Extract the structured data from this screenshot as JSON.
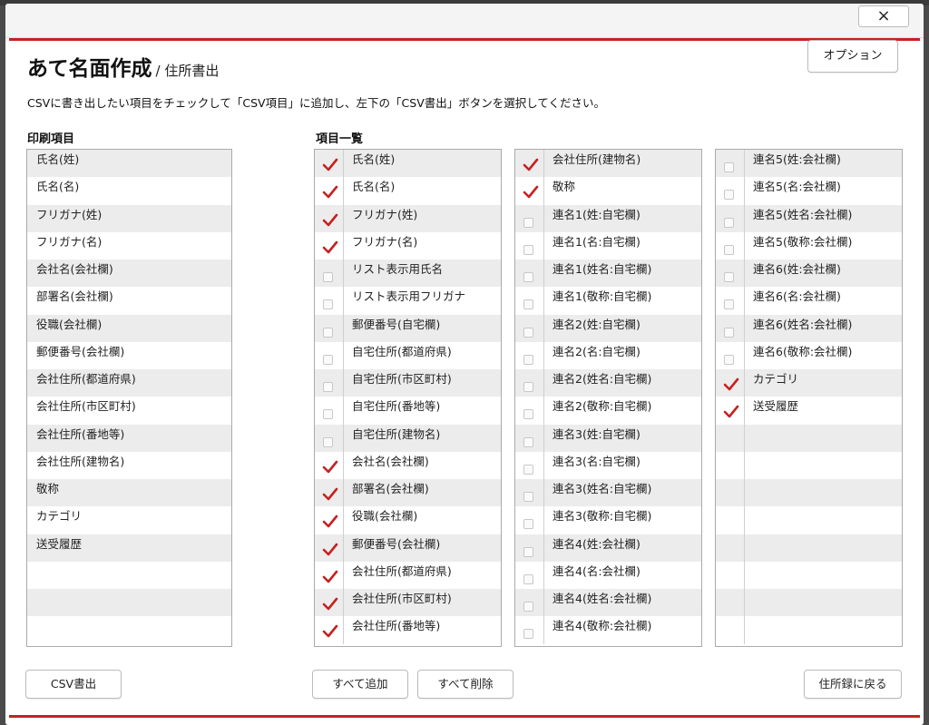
{
  "window": {
    "close_label": "×"
  },
  "header": {
    "title": "あて名面作成",
    "subtitle": "/ 住所書出",
    "options_label": "オプション"
  },
  "instruction": "CSVに書き出したい項目をチェックして「CSV項目」に追加し、左下の「CSV書出」ボタンを選択してください。",
  "print_items": {
    "label": "印刷項目",
    "items": [
      "氏名(姓)",
      "氏名(名)",
      "フリガナ(姓)",
      "フリガナ(名)",
      "会社名(会社欄)",
      "部署名(会社欄)",
      "役職(会社欄)",
      "郵便番号(会社欄)",
      "会社住所(都道府県)",
      "会社住所(市区町村)",
      "会社住所(番地等)",
      "会社住所(建物名)",
      "敬称",
      "カテゴリ",
      "送受履歴",
      "",
      "",
      ""
    ]
  },
  "item_list": {
    "label": "項目一覧",
    "columns": [
      [
        {
          "label": "氏名(姓)",
          "checked": true
        },
        {
          "label": "氏名(名)",
          "checked": true
        },
        {
          "label": "フリガナ(姓)",
          "checked": true
        },
        {
          "label": "フリガナ(名)",
          "checked": true
        },
        {
          "label": "リスト表示用氏名",
          "checked": false
        },
        {
          "label": "リスト表示用フリガナ",
          "checked": false
        },
        {
          "label": "郵便番号(自宅欄)",
          "checked": false
        },
        {
          "label": "自宅住所(都道府県)",
          "checked": false
        },
        {
          "label": "自宅住所(市区町村)",
          "checked": false
        },
        {
          "label": "自宅住所(番地等)",
          "checked": false
        },
        {
          "label": "自宅住所(建物名)",
          "checked": false
        },
        {
          "label": "会社名(会社欄)",
          "checked": true
        },
        {
          "label": "部署名(会社欄)",
          "checked": true
        },
        {
          "label": "役職(会社欄)",
          "checked": true
        },
        {
          "label": "郵便番号(会社欄)",
          "checked": true
        },
        {
          "label": "会社住所(都道府県)",
          "checked": true
        },
        {
          "label": "会社住所(市区町村)",
          "checked": true
        },
        {
          "label": "会社住所(番地等)",
          "checked": true
        }
      ],
      [
        {
          "label": "会社住所(建物名)",
          "checked": true
        },
        {
          "label": "敬称",
          "checked": true
        },
        {
          "label": "連名1(姓:自宅欄)",
          "checked": false
        },
        {
          "label": "連名1(名:自宅欄)",
          "checked": false
        },
        {
          "label": "連名1(姓名:自宅欄)",
          "checked": false
        },
        {
          "label": "連名1(敬称:自宅欄)",
          "checked": false
        },
        {
          "label": "連名2(姓:自宅欄)",
          "checked": false
        },
        {
          "label": "連名2(名:自宅欄)",
          "checked": false
        },
        {
          "label": "連名2(姓名:自宅欄)",
          "checked": false
        },
        {
          "label": "連名2(敬称:自宅欄)",
          "checked": false
        },
        {
          "label": "連名3(姓:自宅欄)",
          "checked": false
        },
        {
          "label": "連名3(名:自宅欄)",
          "checked": false
        },
        {
          "label": "連名3(姓名:自宅欄)",
          "checked": false
        },
        {
          "label": "連名3(敬称:自宅欄)",
          "checked": false
        },
        {
          "label": "連名4(姓:会社欄)",
          "checked": false
        },
        {
          "label": "連名4(名:会社欄)",
          "checked": false
        },
        {
          "label": "連名4(姓名:会社欄)",
          "checked": false
        },
        {
          "label": "連名4(敬称:会社欄)",
          "checked": false
        }
      ],
      [
        {
          "label": "連名5(姓:会社欄)",
          "checked": false
        },
        {
          "label": "連名5(名:会社欄)",
          "checked": false
        },
        {
          "label": "連名5(姓名:会社欄)",
          "checked": false
        },
        {
          "label": "連名5(敬称:会社欄)",
          "checked": false
        },
        {
          "label": "連名6(姓:会社欄)",
          "checked": false
        },
        {
          "label": "連名6(名:会社欄)",
          "checked": false
        },
        {
          "label": "連名6(姓名:会社欄)",
          "checked": false
        },
        {
          "label": "連名6(敬称:会社欄)",
          "checked": false
        },
        {
          "label": "カテゴリ",
          "checked": true
        },
        {
          "label": "送受履歴",
          "checked": true
        }
      ]
    ]
  },
  "footer": {
    "csv_export_label": "CSV書出",
    "add_all_label": "すべて追加",
    "remove_all_label": "すべて削除",
    "back_label": "住所録に戻る"
  },
  "colors": {
    "accent": "#c62121",
    "check": "#c62121"
  }
}
